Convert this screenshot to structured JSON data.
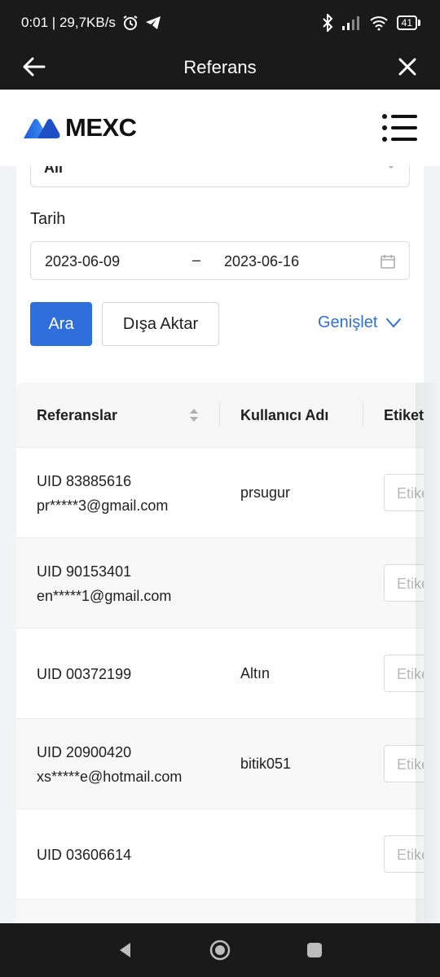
{
  "status_bar": {
    "time_speed": "0:01 | 29,7KB/s",
    "battery": "41"
  },
  "app_bar": {
    "title": "Referans"
  },
  "header": {
    "logo_text": "MEXC"
  },
  "filters": {
    "select_value": "All",
    "date_label": "Tarih",
    "date_start": "2023-06-09",
    "date_separator": "–",
    "date_end": "2023-06-16",
    "search_label": "Ara",
    "export_label": "Dışa Aktar",
    "expand_label": "Genişlet"
  },
  "table": {
    "columns": [
      "Referanslar",
      "Kullanıcı Adı",
      "Etiket"
    ],
    "tag_placeholder": "Etiket",
    "rows": [
      {
        "uid": "UID 83885616",
        "email": "pr*****3@gmail.com",
        "username": "prsugur"
      },
      {
        "uid": "UID 90153401",
        "email": "en*****1@gmail.com",
        "username": ""
      },
      {
        "uid": "UID 00372199",
        "email": "",
        "username": "Altın"
      },
      {
        "uid": "UID 20900420",
        "email": "xs*****e@hotmail.com",
        "username": "bitik051"
      },
      {
        "uid": "UID 03606614",
        "email": "",
        "username": ""
      }
    ]
  },
  "colors": {
    "accent": "#2f6fdc",
    "dark_bar": "#1a1a1a",
    "page_bg": "#f2f3f5"
  }
}
